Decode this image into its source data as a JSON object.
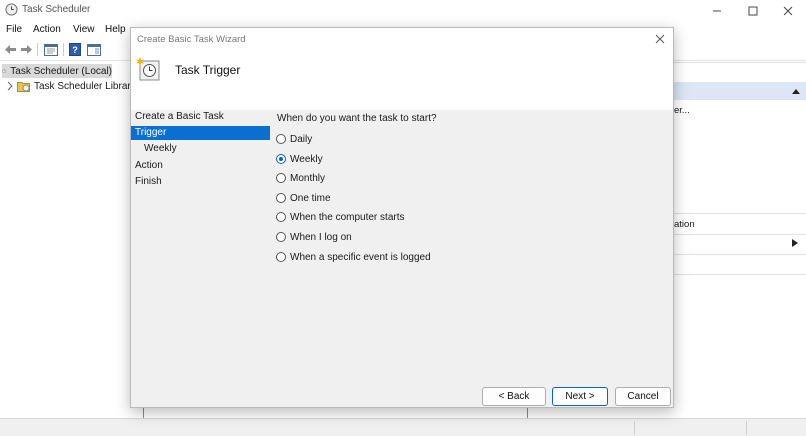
{
  "window": {
    "title": "Task Scheduler"
  },
  "menu": [
    "File",
    "Action",
    "View",
    "Help"
  ],
  "tree": {
    "items": [
      "Task Scheduler (Local)",
      "Task Scheduler Library"
    ]
  },
  "right_pane": {
    "item1": "er...",
    "item2": "ation"
  },
  "dialog": {
    "title": "Create Basic Task Wizard",
    "header_title": "Task Trigger",
    "steps": [
      "Create a Basic Task",
      "Trigger",
      "Weekly",
      "Action",
      "Finish"
    ],
    "active_step": "Trigger",
    "question": "When do you want the task to start?",
    "options": [
      "Daily",
      "Weekly",
      "Monthly",
      "One time",
      "When the computer starts",
      "When I log on",
      "When a specific event is logged"
    ],
    "selected_option": "Weekly",
    "buttons": {
      "back": "< Back",
      "next": "Next >",
      "cancel": "Cancel"
    }
  },
  "colors": {
    "accent": "#0a6fd1",
    "selection_bg": "#d9d9d9",
    "dialog_bg": "#f0f0f0",
    "header_band": "#dce6f4"
  }
}
